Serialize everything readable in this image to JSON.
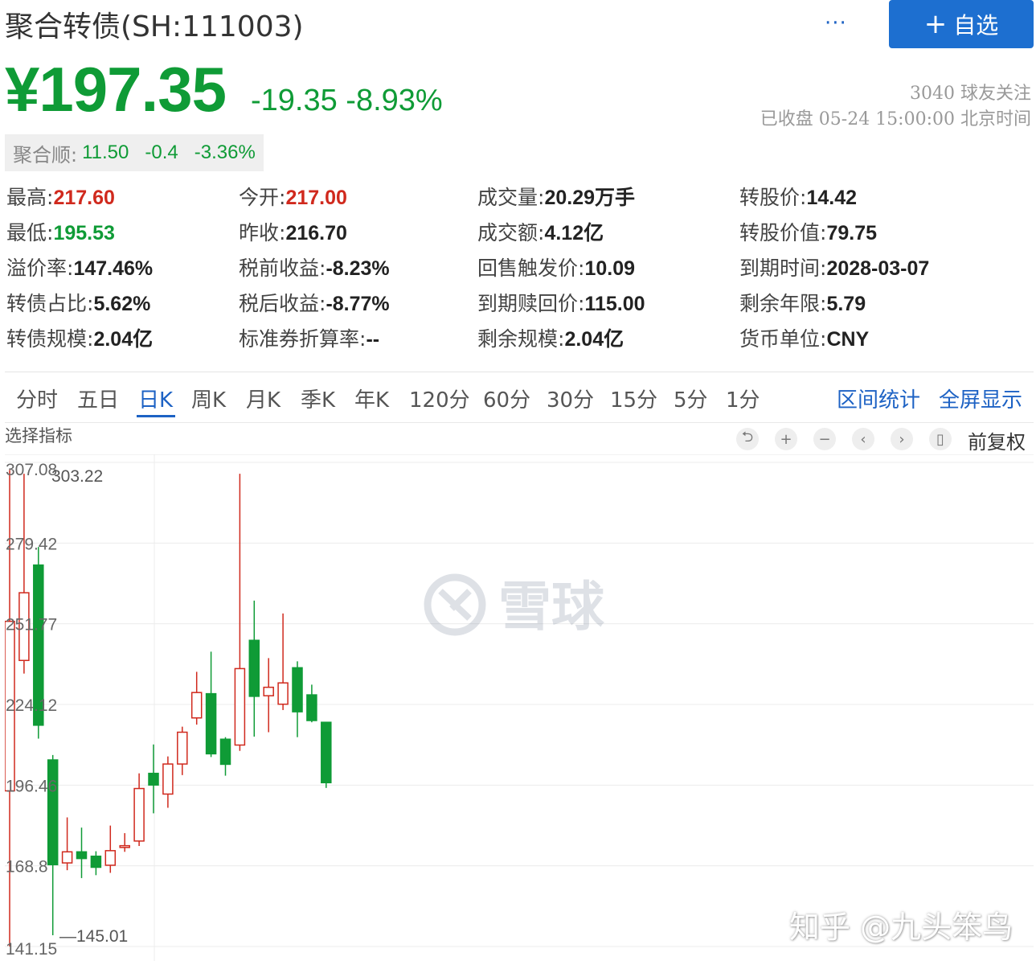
{
  "header": {
    "title": "聚合转债(SH:111003)",
    "more_label": "···",
    "follow_label": "自选",
    "follow_plus": "+"
  },
  "quote": {
    "price": "¥197.35",
    "change": "-19.35 -8.93%",
    "fans": "3040 球友关注",
    "status": "已收盘 05-24 15:00:00 北京时间"
  },
  "underlying": {
    "label": "聚合顺:",
    "price": "11.50",
    "change": "-0.4",
    "pct": "-3.36%"
  },
  "stats": [
    [
      {
        "k": "最高:",
        "v": "217.60",
        "c": "red"
      },
      {
        "k": "今开:",
        "v": "217.00",
        "c": "red"
      },
      {
        "k": "成交量:",
        "v": "20.29万手",
        "c": ""
      },
      {
        "k": "转股价:",
        "v": "14.42",
        "c": ""
      }
    ],
    [
      {
        "k": "最低:",
        "v": "195.53",
        "c": "green"
      },
      {
        "k": "昨收:",
        "v": "216.70",
        "c": ""
      },
      {
        "k": "成交额:",
        "v": "4.12亿",
        "c": ""
      },
      {
        "k": "转股价值:",
        "v": "79.75",
        "c": ""
      }
    ],
    [
      {
        "k": "溢价率:",
        "v": "147.46%",
        "c": ""
      },
      {
        "k": "税前收益:",
        "v": "-8.23%",
        "c": ""
      },
      {
        "k": "回售触发价:",
        "v": "10.09",
        "c": ""
      },
      {
        "k": "到期时间:",
        "v": "2028-03-07",
        "c": ""
      }
    ],
    [
      {
        "k": "转债占比:",
        "v": "5.62%",
        "c": ""
      },
      {
        "k": "税后收益:",
        "v": "-8.77%",
        "c": ""
      },
      {
        "k": "到期赎回价:",
        "v": "115.00",
        "c": ""
      },
      {
        "k": "剩余年限:",
        "v": "5.79",
        "c": ""
      }
    ],
    [
      {
        "k": "转债规模:",
        "v": "2.04亿",
        "c": ""
      },
      {
        "k": "标准券折算率:",
        "v": "--",
        "c": ""
      },
      {
        "k": "剩余规模:",
        "v": "2.04亿",
        "c": ""
      },
      {
        "k": "货币单位:",
        "v": "CNY",
        "c": ""
      }
    ]
  ],
  "tabs": [
    "分时",
    "五日",
    "日K",
    "周K",
    "月K",
    "季K",
    "年K",
    "120分",
    "60分",
    "30分",
    "15分",
    "5分",
    "1分"
  ],
  "active_tab": "日K",
  "tab_actions": [
    "区间统计",
    "全屏显示"
  ],
  "chart_toolbar": {
    "indicator_label": "选择指标",
    "controls": [
      "reset-icon",
      "zoom-in-icon",
      "zoom-out-icon",
      "pan-left-icon",
      "pan-right-icon",
      "candle-icon"
    ],
    "adjust_label": "前复权"
  },
  "chart_data": {
    "type": "candlestick",
    "ylim": [
      141.15,
      307.08
    ],
    "y_ticks": [
      "307.08",
      "279.42",
      "251.77",
      "224.12",
      "196.46",
      "168.8",
      "141.15"
    ],
    "max_label": "303.22",
    "min_label": "145.01",
    "watermark": "雪球",
    "up_color": "#d0291d",
    "down_color": "#0f9b36",
    "candles": [
      {
        "o": 194.5,
        "c": 252.6,
        "h": 304.5,
        "l": 141.2
      },
      {
        "o": 239.2,
        "c": 262.4,
        "h": 303.2,
        "l": 234.7
      },
      {
        "o": 271.9,
        "c": 217.0,
        "h": 278.1,
        "l": 212.4
      },
      {
        "o": 205.1,
        "c": 169.2,
        "h": 206.8,
        "l": 145.0
      },
      {
        "o": 169.8,
        "c": 173.6,
        "h": 185.4,
        "l": 167.3
      },
      {
        "o": 173.6,
        "c": 171.3,
        "h": 181.9,
        "l": 164.6
      },
      {
        "o": 172.1,
        "c": 168.3,
        "h": 173.8,
        "l": 165.6
      },
      {
        "o": 169.0,
        "c": 174.0,
        "h": 182.6,
        "l": 166.4
      },
      {
        "o": 175.1,
        "c": 175.7,
        "h": 180.0,
        "l": 173.6
      },
      {
        "o": 177.3,
        "c": 195.3,
        "h": 200.5,
        "l": 175.6
      },
      {
        "o": 200.5,
        "c": 196.5,
        "h": 210.4,
        "l": 186.8
      },
      {
        "o": 193.4,
        "c": 203.7,
        "h": 206.3,
        "l": 188.7
      },
      {
        "o": 203.7,
        "c": 214.6,
        "h": 216.5,
        "l": 199.9
      },
      {
        "o": 219.5,
        "c": 228.2,
        "h": 235.3,
        "l": 217.2
      },
      {
        "o": 227.8,
        "c": 207.2,
        "h": 242.2,
        "l": 206.1
      },
      {
        "o": 212.2,
        "c": 203.6,
        "h": 212.9,
        "l": 199.7
      },
      {
        "o": 210.2,
        "c": 236.4,
        "h": 303.2,
        "l": 208.2
      },
      {
        "o": 246.1,
        "c": 226.9,
        "h": 259.7,
        "l": 213.1
      },
      {
        "o": 227.1,
        "c": 230.0,
        "h": 240.0,
        "l": 214.6
      },
      {
        "o": 224.2,
        "c": 231.5,
        "h": 255.3,
        "l": 222.2
      },
      {
        "o": 236.7,
        "c": 221.6,
        "h": 238.9,
        "l": 212.9
      },
      {
        "o": 227.4,
        "c": 218.6,
        "h": 230.9,
        "l": 218.0
      },
      {
        "o": 218.0,
        "c": 197.3,
        "h": 217.8,
        "l": 195.5
      }
    ]
  },
  "footer": {
    "watermark": "知乎 @九头笨鸟"
  }
}
